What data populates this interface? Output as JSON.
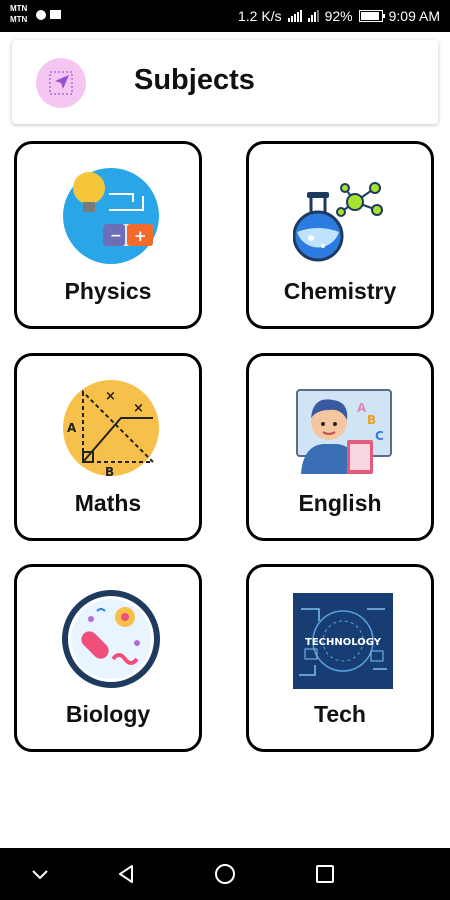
{
  "status_bar": {
    "carrier_1": "MTN",
    "carrier_2": "MTN",
    "speed": "1.2 K/s",
    "battery": "92%",
    "battery_level": 0.92,
    "time": "9:09 AM"
  },
  "app_bar": {
    "title": "Subjects",
    "icon": "send-arrow-icon",
    "icon_bg": "#f6c6f2"
  },
  "subjects": [
    {
      "label": "Physics",
      "icon": "physics-bulb-battery-icon"
    },
    {
      "label": "Chemistry",
      "icon": "chemistry-flask-molecule-icon"
    },
    {
      "label": "Maths",
      "icon": "maths-geometry-icon"
    },
    {
      "label": "English",
      "icon": "english-student-board-icon"
    },
    {
      "label": "Biology",
      "icon": "biology-petri-dish-icon"
    },
    {
      "label": "Tech",
      "icon": "technology-circuit-icon",
      "icon_text": "TECHNOLOGY"
    }
  ],
  "nav_bar": {
    "items": [
      "chevron-down-icon",
      "back-triangle-icon",
      "home-circle-icon",
      "recents-square-icon"
    ]
  }
}
